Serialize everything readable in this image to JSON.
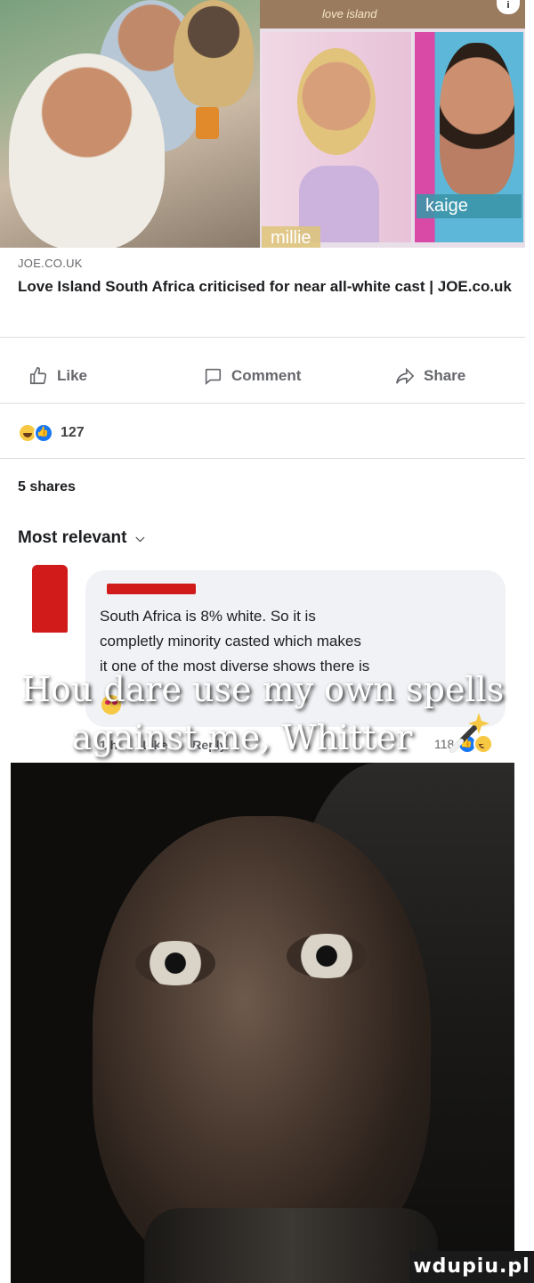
{
  "link_preview": {
    "image_tags": {
      "show_logo": "love island",
      "left_name": "millie",
      "right_name": "kaige"
    },
    "domain": "JOE.CO.UK",
    "headline": "Love Island South Africa criticised for near all-white cast | JOE.co.uk"
  },
  "actions": {
    "like": "Like",
    "comment": "Comment",
    "share": "Share"
  },
  "reactions": {
    "icons": [
      "haha-reaction-icon",
      "like-reaction-icon"
    ],
    "count": "127"
  },
  "shares": "5 shares",
  "sort": {
    "label": "Most relevant",
    "icon": "chevron-down-icon"
  },
  "comment": {
    "lines": [
      "South Africa is 8% white. So it is",
      "completly minority casted which makes",
      "it one of the most diverse shows there is"
    ],
    "emoji": "heart-eyes-emoji",
    "time": "1 h",
    "like": "Like",
    "reply": "Reply",
    "reaction_count": "118"
  },
  "meme": {
    "caption_line1": "Hou dare use my own spells",
    "caption_line2": "against me, Whitter"
  },
  "watermark": "wdupiu.pl",
  "colors": {
    "brand_blue": "#1877f2",
    "muted_text": "#65676b",
    "redaction": "#d11a1a"
  }
}
